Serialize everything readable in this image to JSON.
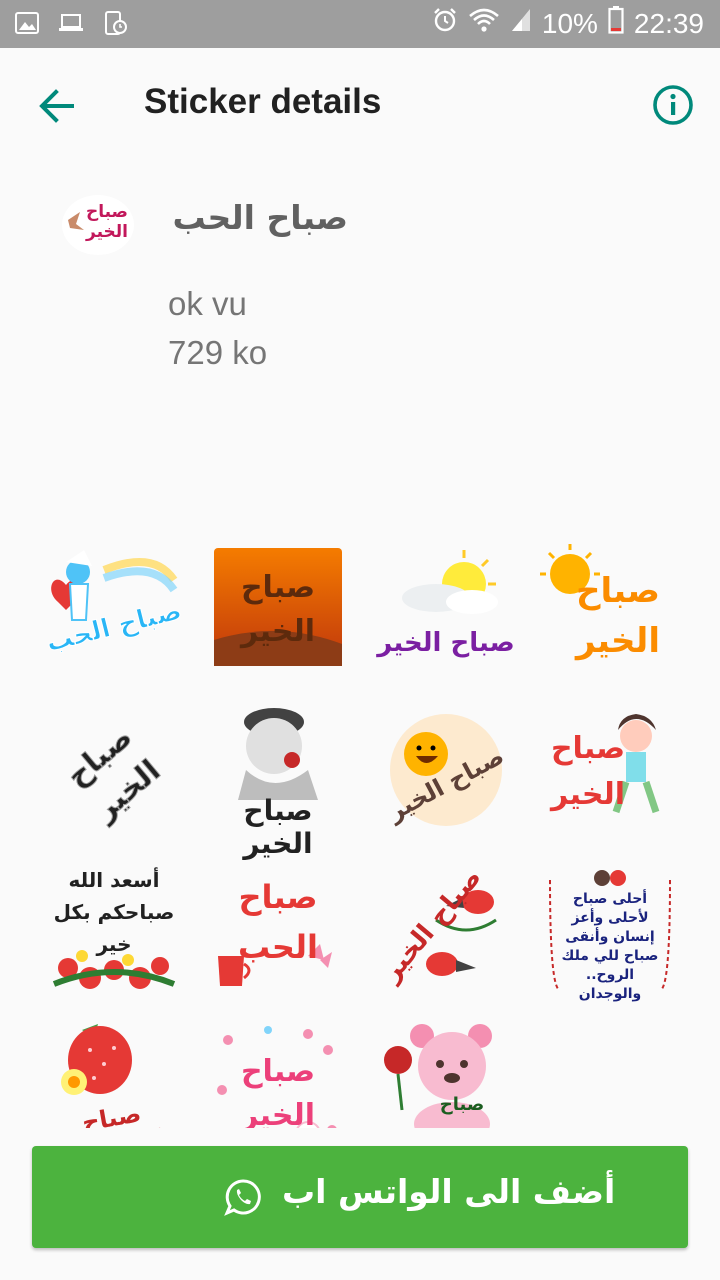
{
  "status_bar": {
    "battery": "10%",
    "time": "22:39",
    "left_icons": [
      "image-icon",
      "laptop-icon",
      "screen-clock-icon"
    ],
    "right_icons": [
      "alarm-icon",
      "wifi-icon",
      "signal-icon",
      "battery-icon"
    ]
  },
  "app_bar": {
    "title": "Sticker details",
    "accent_color": "#00897b"
  },
  "pack": {
    "tray_text": "صباح الخير",
    "name": "صباح الحب",
    "publisher": "ok vu",
    "size": "729 ko"
  },
  "stickers": [
    {
      "text": "صباح الحب"
    },
    {
      "text": "صباح الخير"
    },
    {
      "text": "صباح الخير"
    },
    {
      "text": "صباح الخير"
    },
    {
      "text": "صباح الخير"
    },
    {
      "text": "صباح الخير"
    },
    {
      "text": "صباح الخير"
    },
    {
      "text": "صباح الخير"
    },
    {
      "text": "أسعد الله صباحكم بكل خير"
    },
    {
      "text": "صباح الحب"
    },
    {
      "text": "صباح الخير"
    },
    {
      "text": "أحلى صباح لأحلى وأعز إنسان وأنقى صباح للي ملك الروح.. والوجدان"
    },
    {
      "text": "صباح الفراولة"
    },
    {
      "text": "صباح الخير"
    },
    {
      "text": "صباح"
    }
  ],
  "add_button": {
    "label": "أضف الى الواتس اب",
    "color": "#4cb33e"
  }
}
